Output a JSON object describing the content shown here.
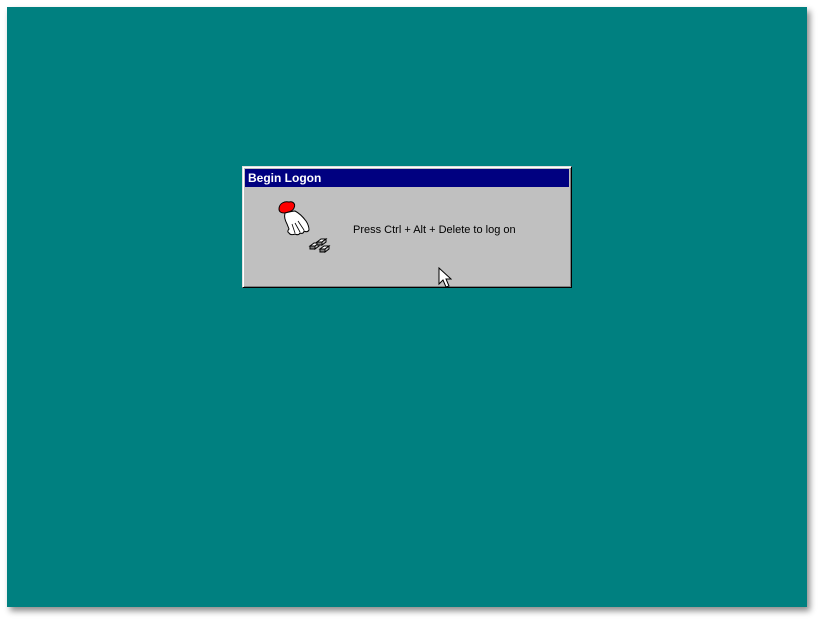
{
  "desktop": {
    "background_color": "#008080"
  },
  "dialog": {
    "title": "Begin Logon",
    "message": "Press Ctrl + Alt + Delete to log on",
    "icon": "hand-pressing-keys-icon",
    "title_bar_color": "#000080",
    "face_color": "#c0c0c0"
  },
  "pointer": {
    "icon": "arrow-cursor-icon"
  }
}
